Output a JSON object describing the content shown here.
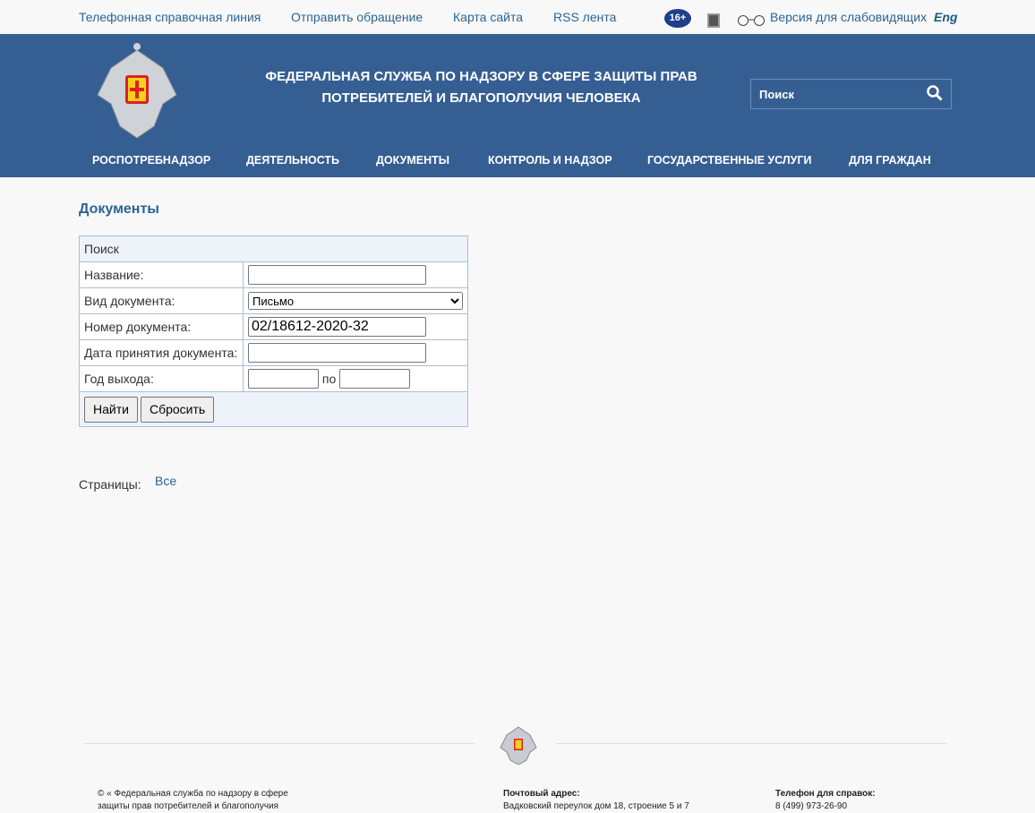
{
  "top_links": [
    "Телефонная справочная линия",
    "Отправить обращение",
    "Карта сайта",
    "RSS лента"
  ],
  "age_badge": "16+",
  "accessibility": "Версия для слабовидящих",
  "lang": "Eng",
  "header": {
    "title_line1": "ФЕДЕРАЛЬНАЯ СЛУЖБА ПО НАДЗОРУ В СФЕРЕ ЗАЩИТЫ ПРАВ",
    "title_line2": "ПОТРЕБИТЕЛЕЙ И БЛАГОПОЛУЧИЯ ЧЕЛОВЕКА",
    "search_placeholder": "Поиск"
  },
  "nav": [
    "РОСПОТРЕБНАДЗОР",
    "ДЕЯТЕЛЬНОСТЬ",
    "ДОКУМЕНТЫ",
    "КОНТРОЛЬ И НАДЗОР",
    "ГОСУДАРСТВЕННЫЕ УСЛУГИ",
    "ДЛЯ ГРАЖДАН"
  ],
  "page_title": "Документы",
  "form": {
    "heading": "Поиск",
    "name_label": "Название:",
    "name_value": "",
    "type_label": "Вид документа:",
    "type_value": "Письмо",
    "number_label": "Номер документа:",
    "number_value": "02/18612-2020-32",
    "date_label": "Дата принятия документа:",
    "date_value": "",
    "year_label": "Год выхода:",
    "year_from": "",
    "year_to_label": "по",
    "year_to": "",
    "find": "Найти",
    "reset": "Сбросить"
  },
  "pages": {
    "label": "Страницы:",
    "all": "Все"
  },
  "footer": {
    "copyright_1": "© « Федеральная служба по надзору в сфере",
    "copyright_2": "защиты прав потребителей и благополучия",
    "address_label": "Почтовый адрес:",
    "address": "Вадковский переулок дом 18, строение 5 и 7",
    "phone_label": "Телефон для справок:",
    "phone": "8 (499) 973-26-90"
  }
}
